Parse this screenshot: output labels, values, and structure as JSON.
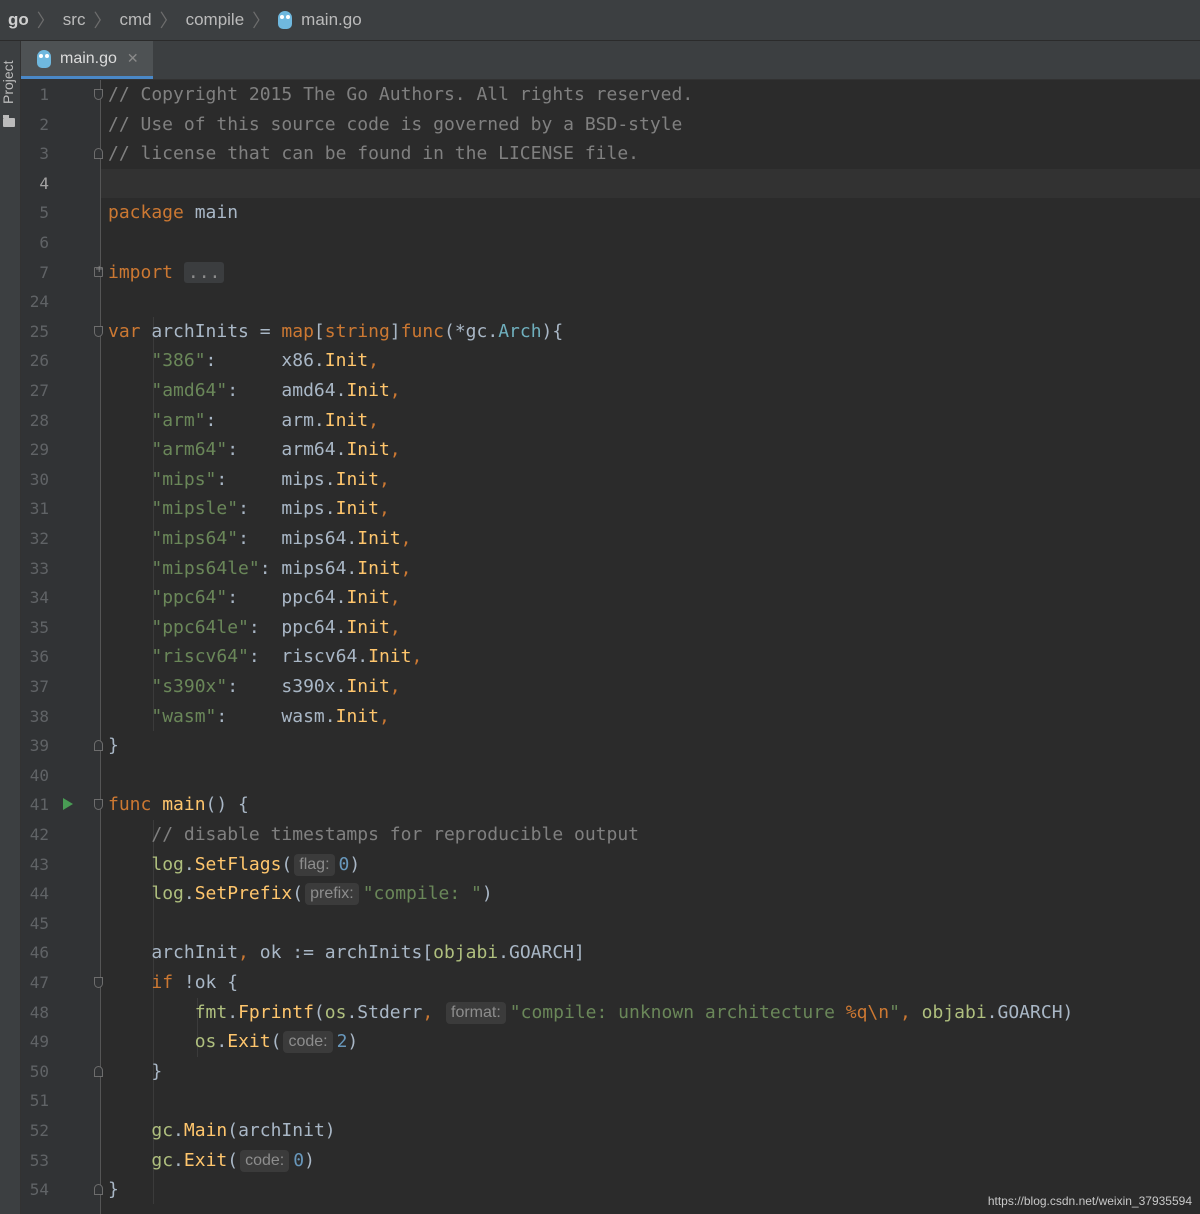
{
  "breadcrumb": [
    "go",
    "src",
    "cmd",
    "compile",
    "main.go"
  ],
  "toolwindow": {
    "label": "Project"
  },
  "tabs": [
    {
      "label": "main.go",
      "active": true
    }
  ],
  "editor": {
    "current_line": 4
  },
  "code_lines": [
    {
      "n": "1",
      "fold": "down",
      "tokens": [
        [
          "cm",
          "// Copyright 2015 The Go Authors. All rights reserved."
        ]
      ]
    },
    {
      "n": "2",
      "tokens": [
        [
          "cm",
          "// Use of this source code is governed by a BSD-style"
        ]
      ]
    },
    {
      "n": "3",
      "fold": "up",
      "tokens": [
        [
          "cm",
          "// license that can be found in the LICENSE file."
        ]
      ]
    },
    {
      "n": "4",
      "tokens": []
    },
    {
      "n": "5",
      "tokens": [
        [
          "kw",
          "package "
        ],
        [
          "plain",
          "main"
        ]
      ]
    },
    {
      "n": "6",
      "tokens": []
    },
    {
      "n": "7",
      "fold": "plus",
      "tokens": [
        [
          "kw",
          "import "
        ],
        [
          "chip",
          "..."
        ]
      ]
    },
    {
      "n": "24",
      "tokens": []
    },
    {
      "n": "25",
      "fold": "down",
      "tokens": [
        [
          "kw",
          "var "
        ],
        [
          "plain",
          "archInits = "
        ],
        [
          "kw",
          "map"
        ],
        [
          "plain",
          "["
        ],
        [
          "kw",
          "string"
        ],
        [
          "plain",
          "]"
        ],
        [
          "kw",
          "func"
        ],
        [
          "plain",
          "(*gc."
        ],
        [
          "typ",
          "Arch"
        ],
        [
          "plain",
          "){"
        ]
      ]
    },
    {
      "n": "26",
      "tokens": [
        [
          "plain",
          "    "
        ],
        [
          "str",
          "\"386\""
        ],
        [
          "plain",
          ":      x86."
        ],
        [
          "fn",
          "Init"
        ],
        [
          "kw",
          ","
        ]
      ]
    },
    {
      "n": "27",
      "tokens": [
        [
          "plain",
          "    "
        ],
        [
          "str",
          "\"amd64\""
        ],
        [
          "plain",
          ":    amd64."
        ],
        [
          "fn",
          "Init"
        ],
        [
          "kw",
          ","
        ]
      ]
    },
    {
      "n": "28",
      "tokens": [
        [
          "plain",
          "    "
        ],
        [
          "str",
          "\"arm\""
        ],
        [
          "plain",
          ":      arm."
        ],
        [
          "fn",
          "Init"
        ],
        [
          "kw",
          ","
        ]
      ]
    },
    {
      "n": "29",
      "tokens": [
        [
          "plain",
          "    "
        ],
        [
          "str",
          "\"arm64\""
        ],
        [
          "plain",
          ":    arm64."
        ],
        [
          "fn",
          "Init"
        ],
        [
          "kw",
          ","
        ]
      ]
    },
    {
      "n": "30",
      "tokens": [
        [
          "plain",
          "    "
        ],
        [
          "str",
          "\"mips\""
        ],
        [
          "plain",
          ":     mips."
        ],
        [
          "fn",
          "Init"
        ],
        [
          "kw",
          ","
        ]
      ]
    },
    {
      "n": "31",
      "tokens": [
        [
          "plain",
          "    "
        ],
        [
          "str",
          "\"mipsle\""
        ],
        [
          "plain",
          ":   mips."
        ],
        [
          "fn",
          "Init"
        ],
        [
          "kw",
          ","
        ]
      ]
    },
    {
      "n": "32",
      "tokens": [
        [
          "plain",
          "    "
        ],
        [
          "str",
          "\"mips64\""
        ],
        [
          "plain",
          ":   mips64."
        ],
        [
          "fn",
          "Init"
        ],
        [
          "kw",
          ","
        ]
      ]
    },
    {
      "n": "33",
      "tokens": [
        [
          "plain",
          "    "
        ],
        [
          "str",
          "\"mips64le\""
        ],
        [
          "plain",
          ": mips64."
        ],
        [
          "fn",
          "Init"
        ],
        [
          "kw",
          ","
        ]
      ]
    },
    {
      "n": "34",
      "tokens": [
        [
          "plain",
          "    "
        ],
        [
          "str",
          "\"ppc64\""
        ],
        [
          "plain",
          ":    ppc64."
        ],
        [
          "fn",
          "Init"
        ],
        [
          "kw",
          ","
        ]
      ]
    },
    {
      "n": "35",
      "tokens": [
        [
          "plain",
          "    "
        ],
        [
          "str",
          "\"ppc64le\""
        ],
        [
          "plain",
          ":  ppc64."
        ],
        [
          "fn",
          "Init"
        ],
        [
          "kw",
          ","
        ]
      ]
    },
    {
      "n": "36",
      "tokens": [
        [
          "plain",
          "    "
        ],
        [
          "str",
          "\"riscv64\""
        ],
        [
          "plain",
          ":  riscv64."
        ],
        [
          "fn",
          "Init"
        ],
        [
          "kw",
          ","
        ]
      ]
    },
    {
      "n": "37",
      "tokens": [
        [
          "plain",
          "    "
        ],
        [
          "str",
          "\"s390x\""
        ],
        [
          "plain",
          ":    s390x."
        ],
        [
          "fn",
          "Init"
        ],
        [
          "kw",
          ","
        ]
      ]
    },
    {
      "n": "38",
      "tokens": [
        [
          "plain",
          "    "
        ],
        [
          "str",
          "\"wasm\""
        ],
        [
          "plain",
          ":     wasm."
        ],
        [
          "fn",
          "Init"
        ],
        [
          "kw",
          ","
        ]
      ]
    },
    {
      "n": "39",
      "fold": "up",
      "tokens": [
        [
          "plain",
          "}"
        ]
      ]
    },
    {
      "n": "40",
      "tokens": []
    },
    {
      "n": "41",
      "fold": "down",
      "run": true,
      "tokens": [
        [
          "kw",
          "func "
        ],
        [
          "fn",
          "main"
        ],
        [
          "plain",
          "() {"
        ]
      ]
    },
    {
      "n": "42",
      "tokens": [
        [
          "plain",
          "    "
        ],
        [
          "cm",
          "// disable timestamps for reproducible output"
        ]
      ]
    },
    {
      "n": "43",
      "tokens": [
        [
          "plain",
          "    "
        ],
        [
          "pkg",
          "log"
        ],
        [
          "plain",
          "."
        ],
        [
          "fn",
          "SetFlags"
        ],
        [
          "plain",
          "("
        ],
        [
          "hint",
          "flag:"
        ],
        [
          "num",
          "0"
        ],
        [
          "plain",
          ")"
        ]
      ]
    },
    {
      "n": "44",
      "tokens": [
        [
          "plain",
          "    "
        ],
        [
          "pkg",
          "log"
        ],
        [
          "plain",
          "."
        ],
        [
          "fn",
          "SetPrefix"
        ],
        [
          "plain",
          "("
        ],
        [
          "hint",
          "prefix:"
        ],
        [
          "str",
          "\"compile: \""
        ],
        [
          "plain",
          ")"
        ]
      ]
    },
    {
      "n": "45",
      "tokens": []
    },
    {
      "n": "46",
      "tokens": [
        [
          "plain",
          "    archInit"
        ],
        [
          "kw",
          ","
        ],
        [
          "plain",
          " ok := archInits["
        ],
        [
          "pkg",
          "objabi"
        ],
        [
          "plain",
          ".GOARCH]"
        ]
      ]
    },
    {
      "n": "47",
      "fold": "down",
      "tokens": [
        [
          "plain",
          "    "
        ],
        [
          "kw",
          "if "
        ],
        [
          "plain",
          "!ok {"
        ]
      ]
    },
    {
      "n": "48",
      "tokens": [
        [
          "plain",
          "        "
        ],
        [
          "pkg",
          "fmt"
        ],
        [
          "plain",
          "."
        ],
        [
          "fn",
          "Fprintf"
        ],
        [
          "plain",
          "("
        ],
        [
          "pkg",
          "os"
        ],
        [
          "plain",
          ".Stderr"
        ],
        [
          "kw",
          ","
        ],
        [
          "plain",
          " "
        ],
        [
          "hint",
          "format:"
        ],
        [
          "str",
          "\"compile: unknown architecture "
        ],
        [
          "kw",
          "%q\\n"
        ],
        [
          "str",
          "\""
        ],
        [
          "kw",
          ","
        ],
        [
          "plain",
          " "
        ],
        [
          "pkg",
          "objabi"
        ],
        [
          "plain",
          ".GOARCH)"
        ]
      ]
    },
    {
      "n": "49",
      "tokens": [
        [
          "plain",
          "        "
        ],
        [
          "pkg",
          "os"
        ],
        [
          "plain",
          "."
        ],
        [
          "fn",
          "Exit"
        ],
        [
          "plain",
          "("
        ],
        [
          "hint",
          "code:"
        ],
        [
          "num",
          "2"
        ],
        [
          "plain",
          ")"
        ]
      ]
    },
    {
      "n": "50",
      "fold": "up",
      "tokens": [
        [
          "plain",
          "    }"
        ]
      ]
    },
    {
      "n": "51",
      "tokens": []
    },
    {
      "n": "52",
      "tokens": [
        [
          "plain",
          "    "
        ],
        [
          "pkg",
          "gc"
        ],
        [
          "plain",
          "."
        ],
        [
          "fn",
          "Main"
        ],
        [
          "plain",
          "(archInit)"
        ]
      ]
    },
    {
      "n": "53",
      "tokens": [
        [
          "plain",
          "    "
        ],
        [
          "pkg",
          "gc"
        ],
        [
          "plain",
          "."
        ],
        [
          "fn",
          "Exit"
        ],
        [
          "plain",
          "("
        ],
        [
          "hint",
          "code:"
        ],
        [
          "num",
          "0"
        ],
        [
          "plain",
          ")"
        ]
      ]
    },
    {
      "n": "54",
      "fold": "up",
      "tokens": [
        [
          "plain",
          "}"
        ]
      ]
    }
  ],
  "watermark": "https://blog.csdn.net/weixin_37935594",
  "colors": {
    "keyword": "#cc7832",
    "string": "#6a8759",
    "comment": "#808080",
    "number": "#6897bb",
    "function": "#ffc66d",
    "package": "#afbf7e",
    "type": "#6fafbd",
    "background": "#2b2b2b",
    "tab_underline": "#4a88c7",
    "run": "#499c54"
  }
}
